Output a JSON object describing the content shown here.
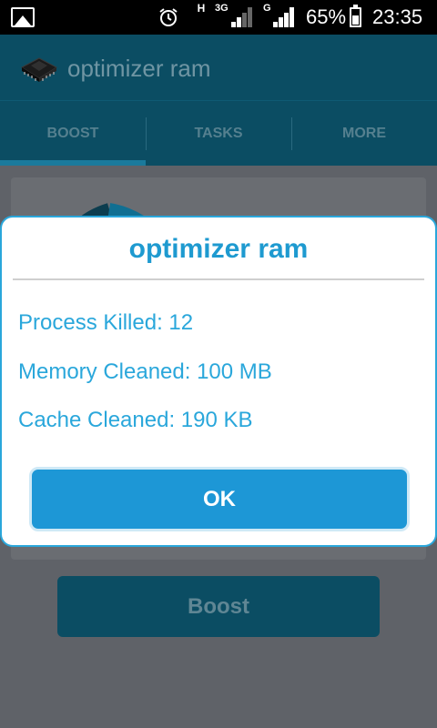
{
  "status_bar": {
    "net_h": "H",
    "net_3g": "3G",
    "net_g": "G",
    "battery_percent": "65%",
    "time": "23:35"
  },
  "app": {
    "title": "optimizer ram"
  },
  "tabs": [
    {
      "label": "BOOST"
    },
    {
      "label": "TASKS"
    },
    {
      "label": "MORE"
    }
  ],
  "main": {
    "boost_label": "Boost"
  },
  "dialog": {
    "title": "optimizer ram",
    "lines": [
      "Process Killed: 12",
      "Memory Cleaned: 100 MB",
      "Cache Cleaned: 190 KB"
    ],
    "ok_label": "OK"
  },
  "colors": {
    "accent": "#1d97d6",
    "action_bar": "#0b4d63",
    "dialog_text": "#2aa7db"
  }
}
